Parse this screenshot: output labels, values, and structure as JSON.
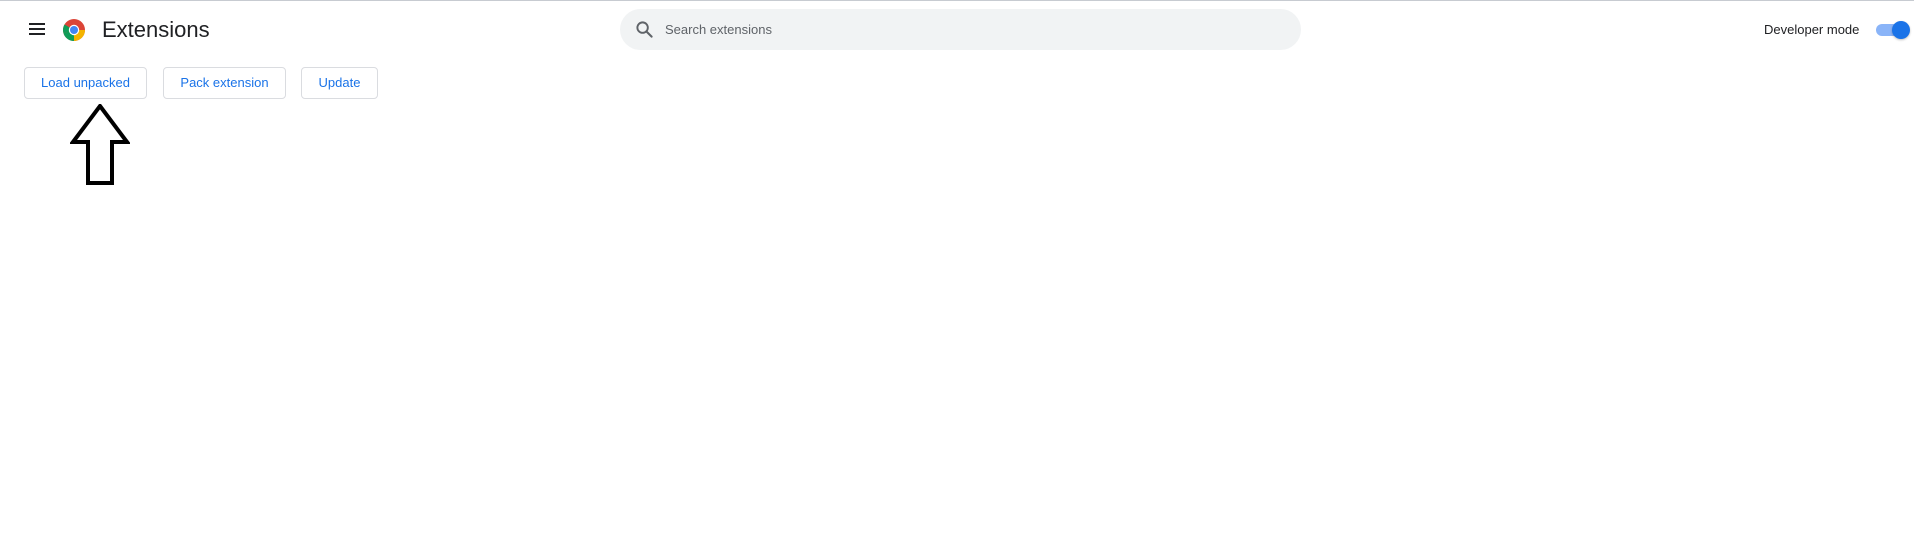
{
  "header": {
    "title": "Extensions",
    "menu_icon": "hamburger-menu-icon",
    "logo_icon": "chrome-logo-icon"
  },
  "search": {
    "placeholder": "Search extensions",
    "value": "",
    "icon": "search-icon"
  },
  "developer_mode": {
    "label": "Developer mode",
    "enabled": true
  },
  "actions": {
    "load_unpacked": "Load unpacked",
    "pack_extension": "Pack extension",
    "update": "Update"
  },
  "annotation": {
    "icon": "up-arrow-icon"
  },
  "colors": {
    "accent": "#1a73e8",
    "toggle_track": "#8ab4f8",
    "search_bg": "#f1f3f4",
    "button_border": "#dadce0"
  }
}
